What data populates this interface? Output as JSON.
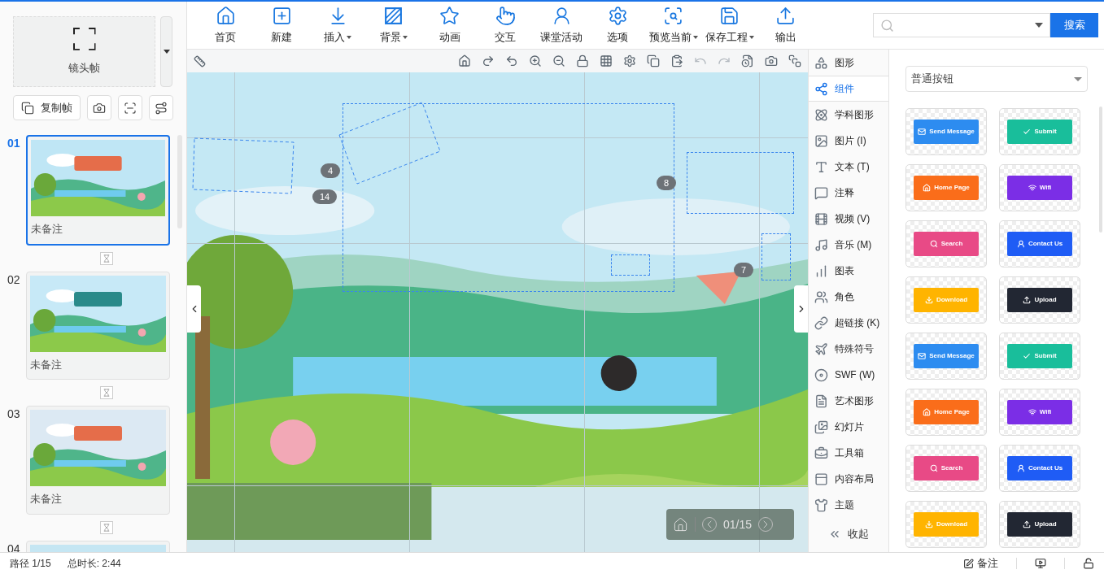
{
  "frame_box": {
    "label": "镜头帧"
  },
  "frame_actions": [
    {
      "kind": "copy",
      "label": "复制帧"
    },
    {
      "kind": "camera"
    },
    {
      "kind": "scan"
    },
    {
      "kind": "route"
    }
  ],
  "slides": [
    {
      "number": "01",
      "note": "未备注",
      "selected": true
    },
    {
      "number": "02",
      "note": "未备注",
      "selected": false
    },
    {
      "number": "03",
      "note": "未备注",
      "selected": false
    },
    {
      "number": "04",
      "selected": false
    }
  ],
  "toolbar": [
    {
      "label": "首页",
      "dropdown": false
    },
    {
      "label": "新建",
      "dropdown": false
    },
    {
      "label": "插入",
      "dropdown": true
    },
    {
      "label": "背景",
      "dropdown": true
    },
    {
      "label": "动画",
      "dropdown": false
    },
    {
      "label": "交互",
      "dropdown": false
    },
    {
      "label": "课堂活动",
      "dropdown": false
    },
    {
      "label": "选项",
      "dropdown": false
    },
    {
      "label": "预览当前",
      "dropdown": true
    },
    {
      "label": "保存工程",
      "dropdown": true
    },
    {
      "label": "输出",
      "dropdown": false
    }
  ],
  "search": {
    "button": "搜索"
  },
  "canvas": {
    "badges": [
      "4",
      "14",
      "8",
      "7"
    ],
    "nav": {
      "page": "01/15"
    }
  },
  "tools": [
    {
      "label": "图形",
      "selected": false
    },
    {
      "label": "组件",
      "selected": true
    },
    {
      "label": "学科图形",
      "selected": false
    },
    {
      "label": "图片 (I)",
      "selected": false
    },
    {
      "label": "文本 (T)",
      "selected": false
    },
    {
      "label": "注释",
      "selected": false
    },
    {
      "label": "视频 (V)",
      "selected": false
    },
    {
      "label": "音乐 (M)",
      "selected": false
    },
    {
      "label": "图表",
      "selected": false
    },
    {
      "label": "角色",
      "selected": false
    },
    {
      "label": "超链接 (K)",
      "selected": false
    },
    {
      "label": "特殊符号",
      "selected": false
    },
    {
      "label": "SWF (W)",
      "selected": false
    },
    {
      "label": "艺术图形",
      "selected": false
    },
    {
      "label": "幻灯片",
      "selected": false
    },
    {
      "label": "工具箱",
      "selected": false
    },
    {
      "label": "内容布局",
      "selected": false
    },
    {
      "label": "主题",
      "selected": false
    }
  ],
  "collapse": {
    "label": "收起"
  },
  "components": {
    "category": "普通按钮",
    "items": [
      {
        "label": "Send Message",
        "color": "#2d8cf0"
      },
      {
        "label": "Submit",
        "color": "#19be9b"
      },
      {
        "label": "Home Page",
        "color": "#fa6d1a"
      },
      {
        "label": "Wifi",
        "color": "#7b2ee6"
      },
      {
        "label": "Search",
        "color": "#e84a86"
      },
      {
        "label": "Contact Us",
        "color": "#1f5cf5"
      },
      {
        "label": "Download",
        "color": "#ffb400"
      },
      {
        "label": "Upload",
        "color": "#222733"
      },
      {
        "label": "Send Message",
        "color": "#2d8cf0"
      },
      {
        "label": "Submit",
        "color": "#19be9b"
      },
      {
        "label": "Home Page",
        "color": "#fa6d1a"
      },
      {
        "label": "Wifi",
        "color": "#7b2ee6"
      },
      {
        "label": "Search",
        "color": "#e84a86"
      },
      {
        "label": "Contact Us",
        "color": "#1f5cf5"
      },
      {
        "label": "Download",
        "color": "#ffb400"
      },
      {
        "label": "Upload",
        "color": "#222733"
      }
    ]
  },
  "status_bar": {
    "path": "路径 1/15",
    "duration": "总时长: 2:44",
    "note": "备注"
  }
}
